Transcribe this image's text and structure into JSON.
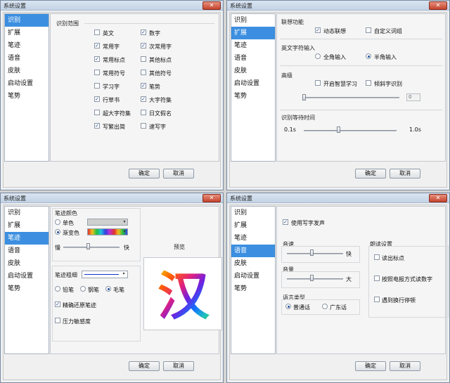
{
  "window_title": "系统设置",
  "close_symbol": "✕",
  "check_mark": "✓",
  "dropdown_arrow": "▾",
  "nav": [
    "识别",
    "扩展",
    "笔迹",
    "语音",
    "皮肤",
    "启动设置",
    "笔势"
  ],
  "buttons": {
    "ok": "确定",
    "cancel": "取消"
  },
  "recognition": {
    "section_title": "识别范围",
    "options": [
      {
        "label": "英文",
        "checked": false
      },
      {
        "label": "数字",
        "checked": true
      },
      {
        "label": "常用字",
        "checked": true
      },
      {
        "label": "次常用字",
        "checked": true
      },
      {
        "label": "常用标点",
        "checked": true
      },
      {
        "label": "其他标点",
        "checked": false
      },
      {
        "label": "常用符号",
        "checked": false
      },
      {
        "label": "其他符号",
        "checked": false
      },
      {
        "label": "学习字",
        "checked": false
      },
      {
        "label": "笔势",
        "checked": true
      },
      {
        "label": "行草书",
        "checked": true
      },
      {
        "label": "大字符集",
        "checked": true
      },
      {
        "label": "超大字符集",
        "checked": false
      },
      {
        "label": "日文假名",
        "checked": false
      },
      {
        "label": "写繁出简",
        "checked": true
      },
      {
        "label": "速写字",
        "checked": false
      }
    ]
  },
  "extension": {
    "assoc_title": "联想功能",
    "dynamic_assoc": "动态联想",
    "custom_phrase": "自定义词组",
    "en_title": "英文字符输入",
    "fullwidth": "全角输入",
    "halfwidth": "半角输入",
    "adv_title": "高级",
    "smart_learn": "开启智慧学习",
    "slant_recog": "倾斜字识别",
    "slider_value": "0",
    "wait_title": "识别等待时间",
    "wait_min": "0.1s",
    "wait_max": "1.0s",
    "wait_level": 0.38
  },
  "pen": {
    "color_title": "笔迹颜色",
    "single_color": "单色",
    "gradient_color": "渐变色",
    "slow": "慢",
    "fast": "快",
    "speed_level": 0.45,
    "width_title": "笔迹粗细",
    "pencil": "铅笔",
    "fountain_pen": "钢笔",
    "brush": "毛笔",
    "restore_precise": "精确还原笔迹",
    "pressure": "压力敏感度",
    "preview_title": "预览",
    "preview_char": "汉"
  },
  "voice": {
    "use_voice": "使用写字发声",
    "speed_title": "音速",
    "fast": "快",
    "speed_level": 0.45,
    "volume_title": "音量",
    "loud": "大",
    "volume_level": 0.45,
    "lang_title": "语言类型",
    "mandarin": "普通话",
    "cantonese": "广东话",
    "read_title": "朗读设置",
    "read_punct": "读出标点",
    "read_phone": "按照电报方式读数字",
    "read_newline": "遇到换行停顿"
  }
}
